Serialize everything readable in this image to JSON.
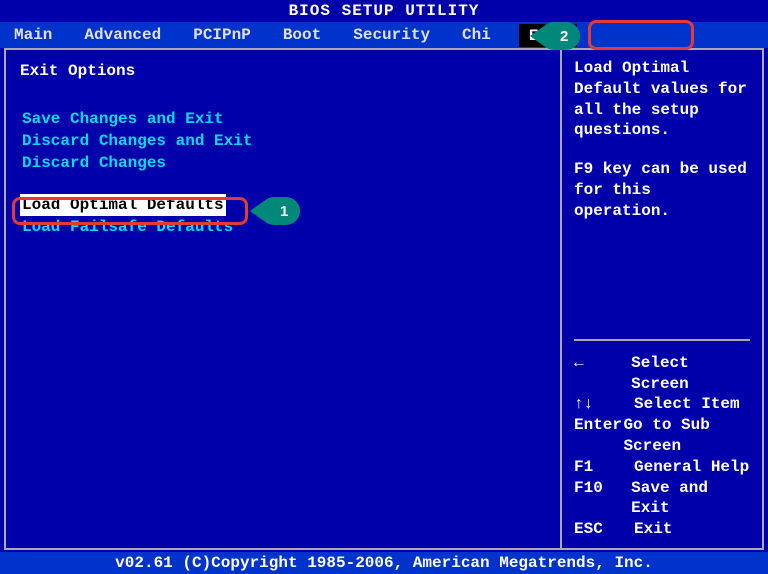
{
  "title": "BIOS SETUP UTILITY",
  "menu": {
    "items": [
      {
        "label": "Main"
      },
      {
        "label": "Advanced"
      },
      {
        "label": "PCIPnP"
      },
      {
        "label": "Boot"
      },
      {
        "label": "Security"
      },
      {
        "label": "Chi"
      },
      {
        "label": "Exit",
        "selected": true
      }
    ]
  },
  "left": {
    "heading": "Exit Options",
    "group1": [
      "Save Changes and Exit",
      "Discard Changes and Exit",
      "Discard Changes"
    ],
    "group2": [
      {
        "label": "Load Optimal Defaults",
        "selected": true
      },
      {
        "label": "Load Failsafe Defaults"
      }
    ]
  },
  "right": {
    "help1": "Load Optimal Default values for all the setup questions.",
    "help2": "F9 key can be used for this operation.",
    "nav": [
      {
        "key": "←",
        "desc": "Select Screen"
      },
      {
        "key": "↑↓",
        "desc": "Select Item"
      },
      {
        "key": "Enter",
        "desc": "Go to Sub Screen"
      },
      {
        "key": "F1",
        "desc": "General Help"
      },
      {
        "key": "F10",
        "desc": "Save and Exit"
      },
      {
        "key": "ESC",
        "desc": "Exit"
      }
    ]
  },
  "footer": "v02.61 (C)Copyright 1985-2006, American Megatrends, Inc.",
  "annotations": {
    "b1": "1",
    "b2": "2"
  }
}
